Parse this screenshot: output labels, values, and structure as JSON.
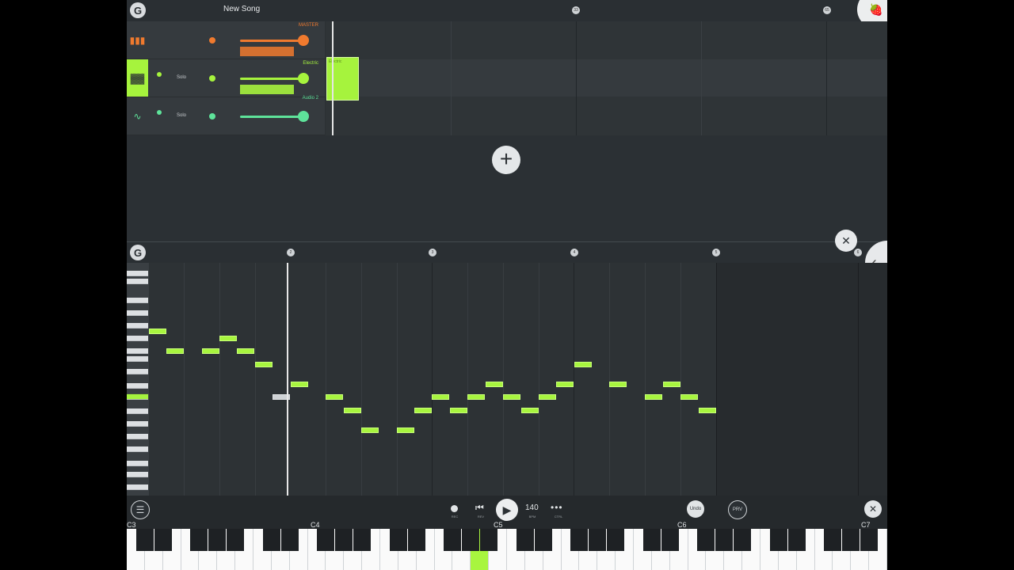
{
  "app": {
    "song_title": "New Song",
    "logo_text": "G"
  },
  "arrangement": {
    "ruler_marks": [
      "33",
      "65"
    ],
    "tracks": [
      {
        "name": "MASTER",
        "icon": "mixer-bars-icon",
        "color": "#f07a2e",
        "solo_label": ""
      },
      {
        "name": "Electric",
        "icon": "piano-keys-icon",
        "color": "#a6f33d",
        "solo_label": "Solo"
      },
      {
        "name": "Audio 2",
        "icon": "waveform-icon",
        "color": "#5ee39a",
        "solo_label": "Solo"
      }
    ],
    "clip_label": "Electric"
  },
  "piano_roll": {
    "ruler_marks": [
      "2",
      "3",
      "4",
      "5",
      "6"
    ],
    "key_labels": [
      "C6",
      "C5",
      "C4"
    ],
    "note_color": "#a8f53f"
  },
  "transport": {
    "rec_label": "REC",
    "rev_label": "REV",
    "bpm_value": "140",
    "bpm_label": "BPM",
    "ctrl_label": "CTRL",
    "undo_label": "Undo",
    "prv_label": "PRV"
  },
  "keyboard": {
    "octave_labels": [
      "C3",
      "C4",
      "C5",
      "C6",
      "C7"
    ]
  },
  "colors": {
    "accent_green": "#a8f53f",
    "master_orange": "#f07a2e",
    "audio_teal": "#5ee39a",
    "background": "#2b3034"
  }
}
